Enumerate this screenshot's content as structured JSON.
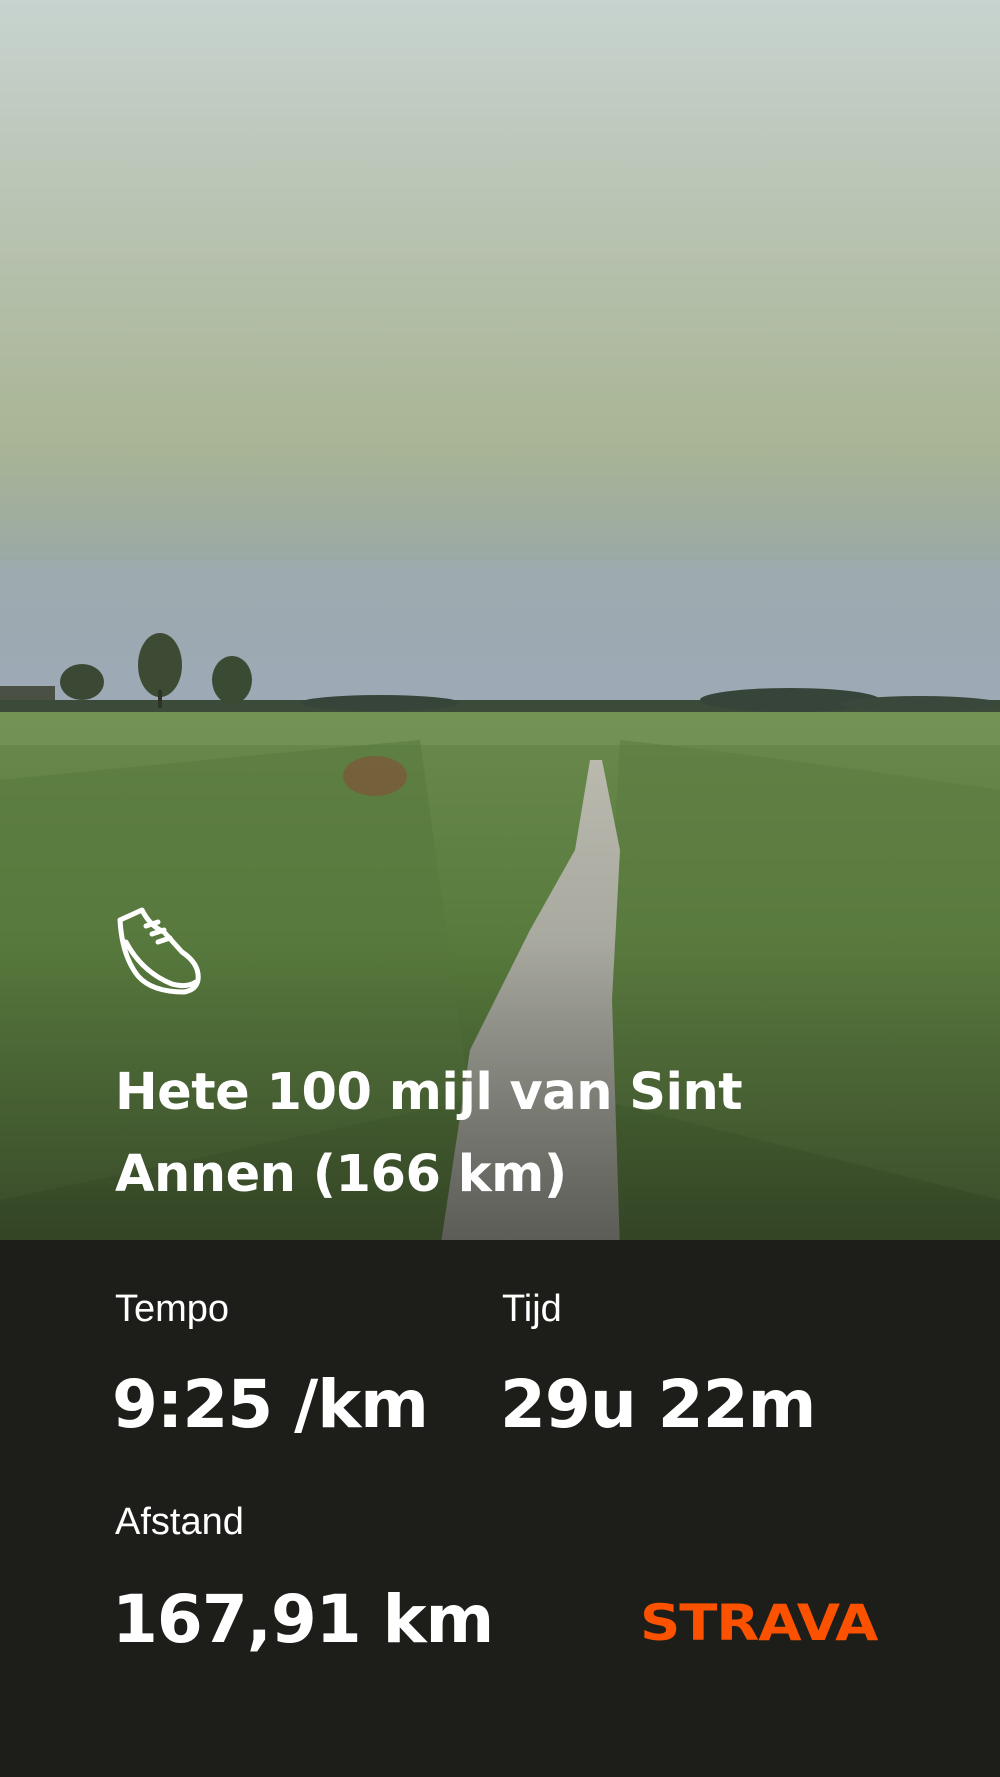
{
  "activity": {
    "icon": "running-shoe-icon",
    "title": "Hete 100 mijl van Sint Annen (166 km)"
  },
  "stats": {
    "tempo": {
      "label": "Tempo",
      "value": "9:25 /km"
    },
    "tijd": {
      "label": "Tijd",
      "value": "29u 22m"
    },
    "afstand": {
      "label": "Afstand",
      "value": "167,91 km"
    }
  },
  "brand": {
    "name": "STRAVA",
    "color": "#fc5200"
  },
  "colors": {
    "overlay_bottom": "#1d1e19",
    "text": "#ffffff"
  }
}
